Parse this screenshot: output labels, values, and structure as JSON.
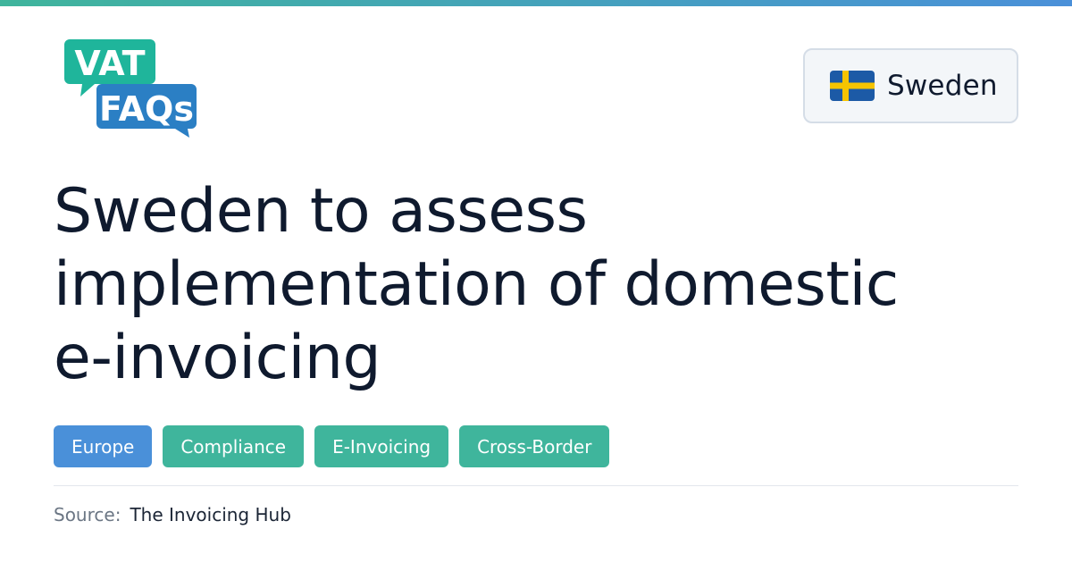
{
  "logo": {
    "line1": "VAT",
    "line2": "FAQs"
  },
  "country": {
    "name": "Sweden"
  },
  "headline": {
    "lines": [
      "Sweden to assess",
      "implementation of domestic",
      "e-invoicing"
    ]
  },
  "tags": [
    {
      "label": "Europe",
      "color": "#4a90d9"
    },
    {
      "label": "Compliance",
      "color": "#3fb59c"
    },
    {
      "label": "E-Invoicing",
      "color": "#3fb59c"
    },
    {
      "label": "Cross-Border",
      "color": "#3fb59c"
    }
  ],
  "source": {
    "label": "Source:",
    "value": "The Invoicing Hub"
  },
  "colors": {
    "accent_teal": "#3fb59c",
    "accent_blue": "#4a90d9",
    "logo_teal": "#1fb59b",
    "logo_blue": "#2b7fc4",
    "flag_blue": "#1c5aa6",
    "flag_yellow": "#f6c400"
  }
}
